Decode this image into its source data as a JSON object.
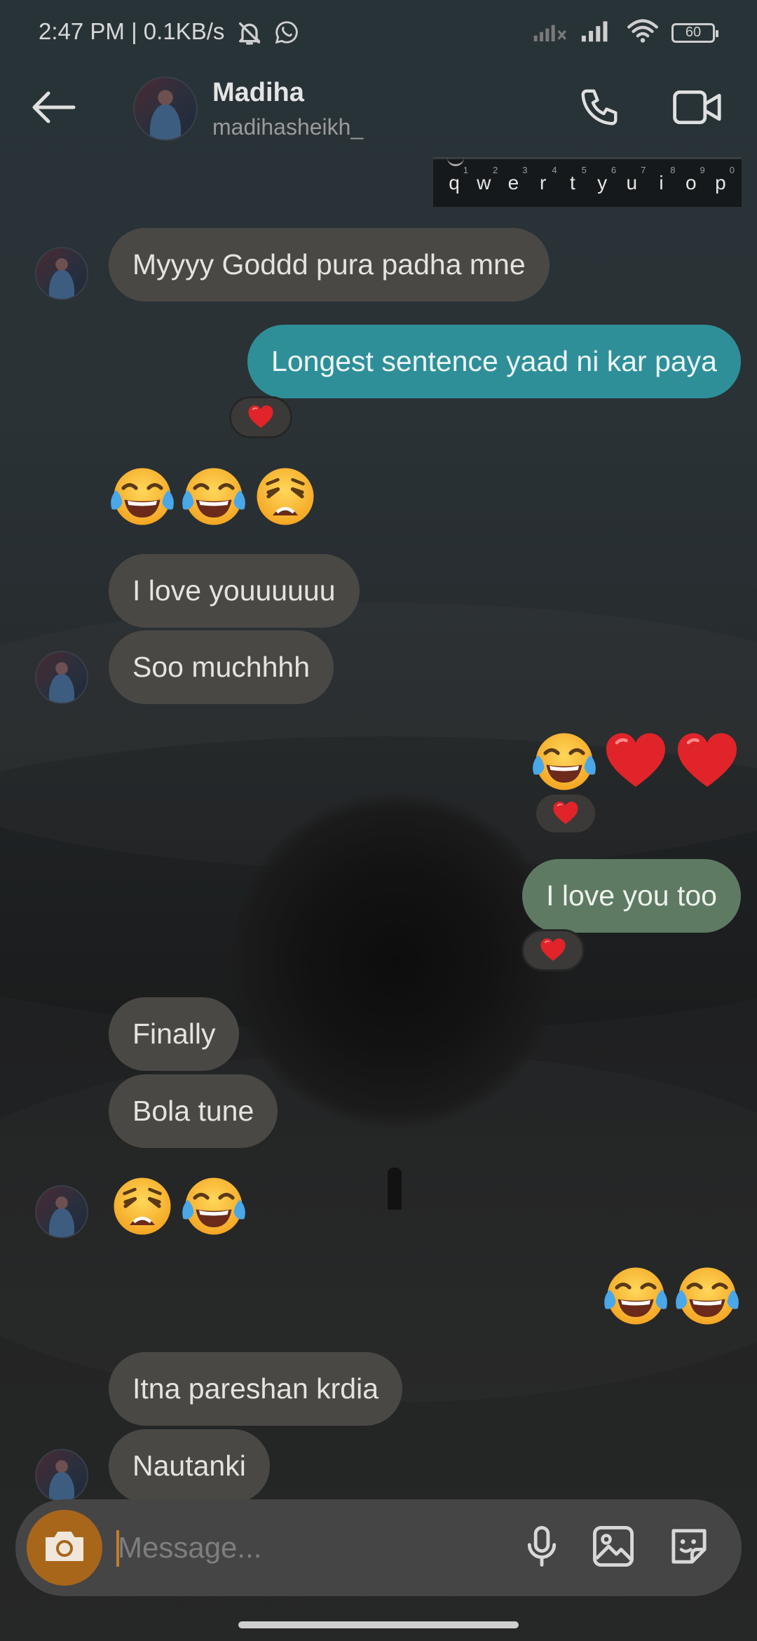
{
  "status_bar": {
    "time": "2:47 PM | 0.1KB/s",
    "icons": [
      "mute-icon",
      "whatsapp-icon"
    ],
    "right_icons": [
      "signal-off-icon",
      "signal-icon",
      "wifi-icon"
    ],
    "battery": "60"
  },
  "header": {
    "back_icon": "arrow-left-icon",
    "name": "Madiha",
    "username": "madihasheikh_",
    "call_icon": "phone-icon",
    "video_icon": "video-camera-icon"
  },
  "keyboard": {
    "keys": [
      "q",
      "w",
      "e",
      "r",
      "t",
      "y",
      "u",
      "i",
      "o",
      "p"
    ],
    "numbers": [
      "1",
      "2",
      "3",
      "4",
      "5",
      "6",
      "7",
      "8",
      "9",
      "0"
    ]
  },
  "messages": [
    {
      "text": "Myyyy Goddd pura padha mne",
      "side": "incoming"
    },
    {
      "text": "Longest sentence yaad ni kar paya",
      "side": "outgoing",
      "color": "#2e8f99",
      "reaction": "❤️"
    },
    {
      "emojis": [
        "face-with-tears-of-joy",
        "face-with-tears-of-joy",
        "weary-face"
      ],
      "side": "incoming"
    },
    {
      "text": "I love youuuuuu",
      "side": "incoming"
    },
    {
      "text": "Soo muchhhh",
      "side": "incoming"
    },
    {
      "emojis": [
        "face-with-tears-of-joy",
        "red-heart",
        "red-heart"
      ],
      "side": "outgoing",
      "reaction": "❤️"
    },
    {
      "text": "I love you too",
      "side": "outgoing",
      "color": "#5e7a63",
      "reaction": "❤️"
    },
    {
      "text": "Finally",
      "side": "incoming"
    },
    {
      "text": "Bola tune",
      "side": "incoming"
    },
    {
      "emojis": [
        "weary-face",
        "face-with-tears-of-joy"
      ],
      "side": "incoming"
    },
    {
      "emojis": [
        "face-with-tears-of-joy",
        "face-with-tears-of-joy"
      ],
      "side": "outgoing"
    },
    {
      "text": "Itna pareshan krdia",
      "side": "incoming"
    },
    {
      "text": "Nautanki",
      "side": "incoming"
    }
  ],
  "composer": {
    "placeholder": "Message...",
    "value": "",
    "camera_icon": "camera-icon",
    "mic_icon": "microphone-icon",
    "gallery_icon": "image-icon",
    "sticker_icon": "sticker-icon"
  },
  "colors": {
    "incoming_bubble": "#4a4845",
    "outgoing_teal": "#2e8f99",
    "outgoing_green": "#5e7a63",
    "camera_button": "#a8661a",
    "composer": "#454545"
  }
}
